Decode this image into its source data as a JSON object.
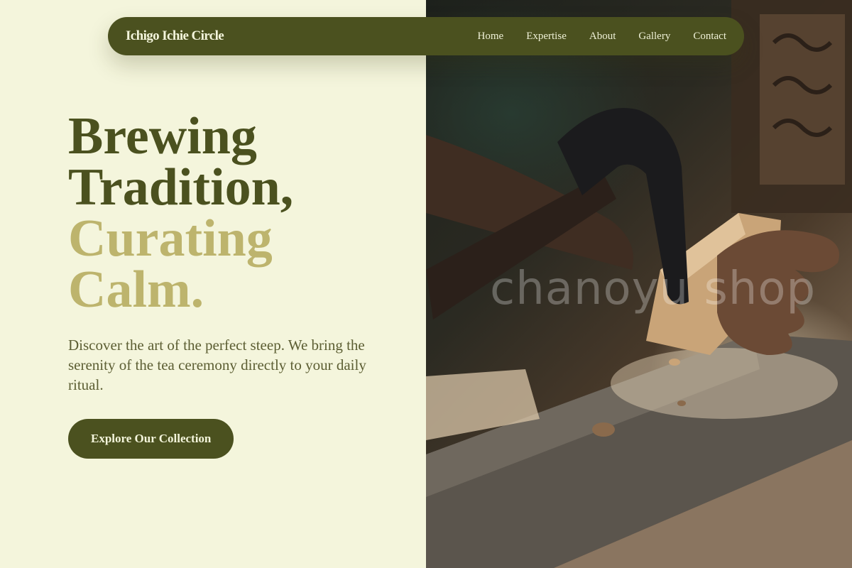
{
  "nav": {
    "brand": "Ichigo Ichie Circle",
    "links": [
      {
        "label": "Home"
      },
      {
        "label": "Expertise"
      },
      {
        "label": "About"
      },
      {
        "label": "Gallery"
      },
      {
        "label": "Contact"
      }
    ]
  },
  "hero": {
    "headline_line1": "Brewing",
    "headline_line2": "Tradition,",
    "headline_line3": "Curating",
    "headline_line4": "Calm.",
    "subtext": "Discover the art of the perfect steep. We bring the serenity of the tea ceremony directly to your daily ritual.",
    "cta_label": "Explore Our Collection"
  },
  "photo": {
    "watermark": "chanoyu shop",
    "subject": "hands-carving-wood-photo"
  },
  "colors": {
    "background": "#f4f5dc",
    "primary": "#4b511f",
    "accent": "#bdb46d",
    "body_text": "#5c5e33"
  }
}
